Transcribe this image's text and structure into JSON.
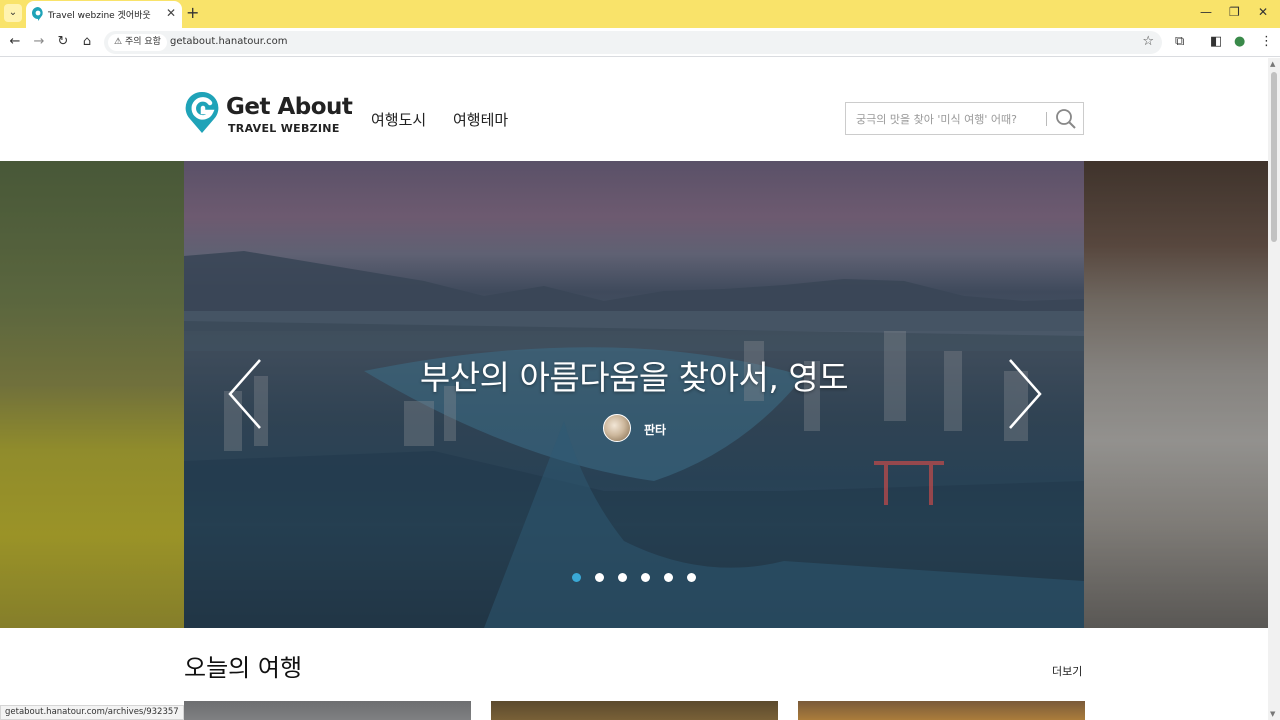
{
  "browser": {
    "tab_title": "Travel webzine 겟어바웃",
    "url": "getabout.hanatour.com",
    "security_label": "주의 요함",
    "status_url": "getabout.hanatour.com/archives/932357"
  },
  "header": {
    "logo_title": "Get About",
    "logo_subtitle": "TRAVEL WEBZINE",
    "nav": [
      "여행도시",
      "여행테마"
    ],
    "search_placeholder": "궁극의 맛을 찾아 '미식 여행' 어때?"
  },
  "hero": {
    "title": "부산의 아름다움을 찾아서, 영도",
    "author": "판타",
    "slide_count": 6,
    "active_slide": 1
  },
  "section": {
    "title": "오늘의 여행",
    "more_label": "더보기"
  },
  "colors": {
    "accent": "#1fa3b8",
    "tabbar": "#f9e36a",
    "active_dot": "#3aa9d6"
  }
}
